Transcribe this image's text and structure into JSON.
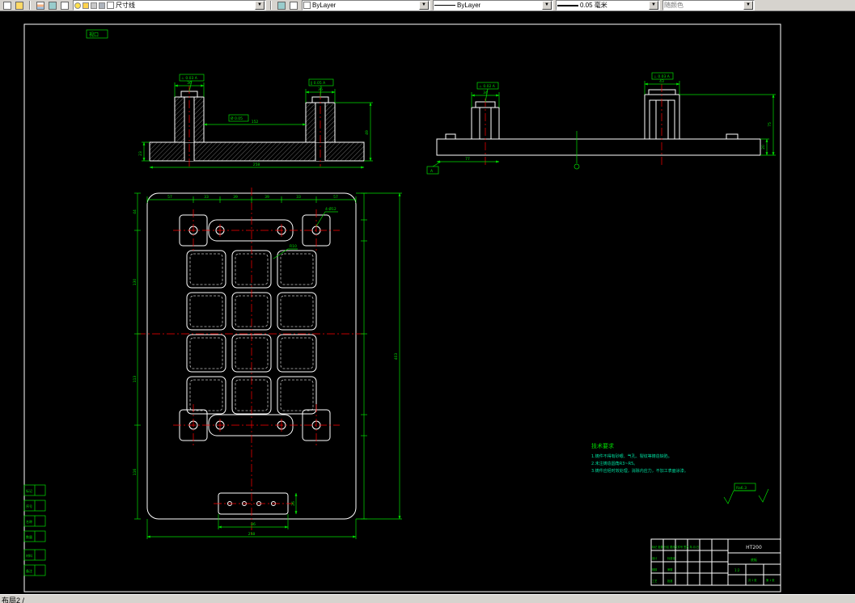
{
  "toolbar": {
    "layer_value": "尺寸线",
    "color_value": "ByLayer",
    "linetype_value": "ByLayer",
    "lineweight_value": "0.05 毫米",
    "plotstyle_value": "随颜色"
  },
  "statusbar": {
    "layout_tab": "布局2 /"
  },
  "colors": {
    "canvas": "#000000",
    "geometry": "#ffffff",
    "dimension": "#00df00",
    "centerline": "#ff0000",
    "notes": "#00dfa0",
    "toolbar_bg": "#d6d3ce"
  },
  "drawing": {
    "viewport_tag": "视口",
    "edge_boxes": [
      "标记",
      "序号",
      "名称",
      "数量",
      "材料",
      "备注"
    ],
    "notes": {
      "title": "技术要求",
      "line1": "1.铸件不得有砂眼、气孔、裂纹等铸造缺陷。",
      "line2": "2.未注铸造圆角R3~R5。",
      "line3": "3.铸件应经时效处理，消除内应力，不加工表面涂漆。"
    },
    "surface": {
      "ra": "Ra6.3"
    },
    "datums": {
      "d1": "⊥ 0.03 A",
      "d2": "∥ 0.05 A",
      "d3": "⊥ 0.02 A",
      "d4": "A",
      "fcf": "Ø 0.05"
    },
    "dims": {
      "front": {
        "w_boss_l": "36",
        "w_boss_r": "36",
        "between": "152",
        "h_plate": "23",
        "h_right": "49",
        "overall": "258"
      },
      "side": {
        "w_boss_l": "34",
        "w_boss_r": "43",
        "left": "77",
        "h_right1": "75",
        "h_right2": "20"
      },
      "plan": {
        "top": [
          "57",
          "33",
          "39",
          "39",
          "33",
          "57"
        ],
        "left": [
          "44",
          "130",
          "113",
          "116"
        ],
        "right_overall": "403",
        "bottom_inner": "86",
        "bottom_overall": "258",
        "sub_h": "26",
        "leader_r": "R10",
        "leader_holes": "4-Ø12"
      }
    },
    "title_block": {
      "material": "HT200",
      "part_name": "底板",
      "row1": "标记 处数 分区 更改文件号 签名 年.月.日",
      "row2": "设计　　　　标准化",
      "row3": "校核　　　　审核",
      "row4": "工艺　　　　批准",
      "scale": "1:2",
      "sheet1": "共 1 张",
      "sheet2": "第 1 张"
    }
  }
}
